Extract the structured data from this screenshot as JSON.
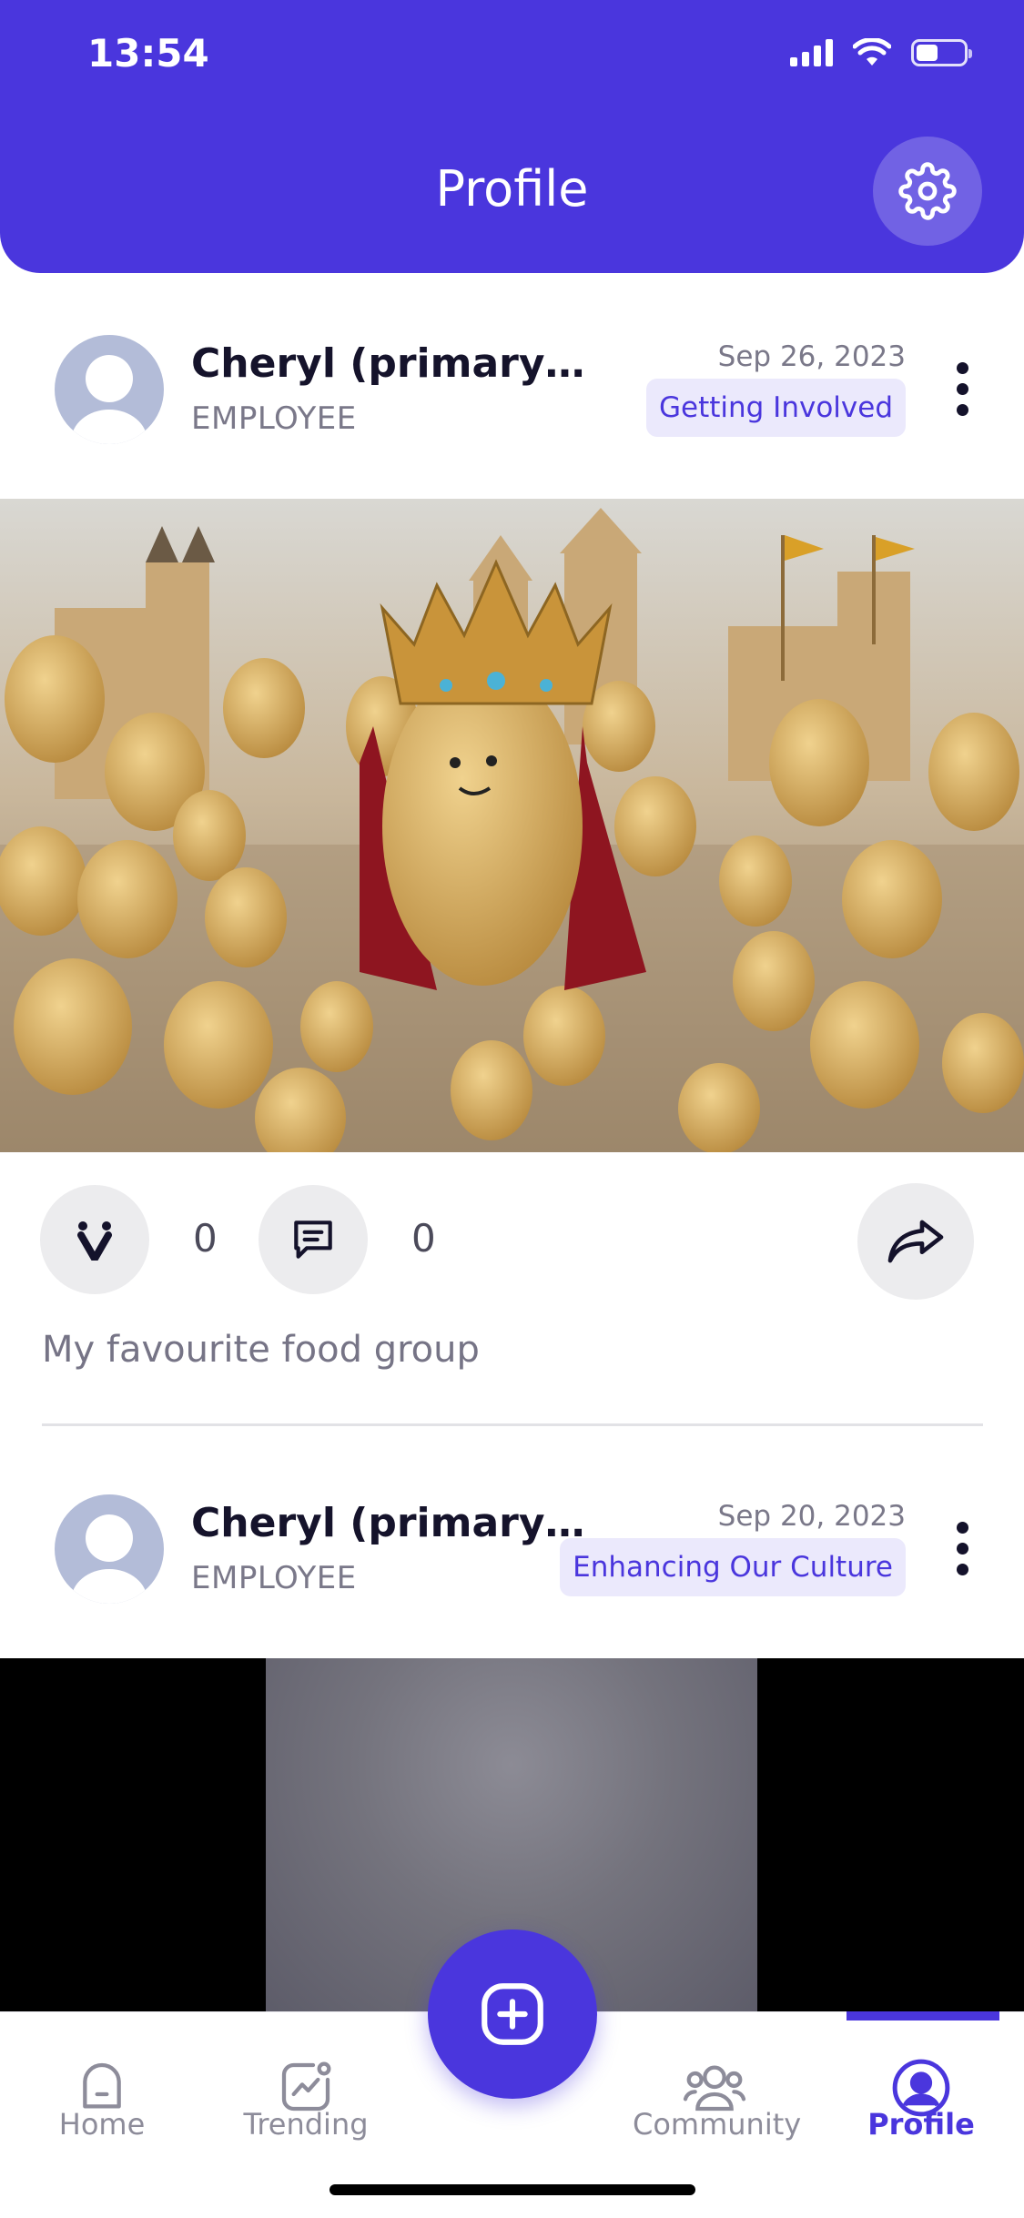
{
  "status": {
    "time": "13:54"
  },
  "header": {
    "title": "Profile"
  },
  "posts": [
    {
      "author": "Cheryl (primary…",
      "role": "EMPLOYEE",
      "date": "Sep 26, 2023",
      "tag": "Getting Involved",
      "reactions": "0",
      "comments": "0",
      "caption": "My favourite food group"
    },
    {
      "author": "Cheryl (primary…",
      "role": "EMPLOYEE",
      "date": "Sep 20, 2023",
      "tag": "Enhancing Our Culture"
    }
  ],
  "nav": {
    "items": [
      {
        "label": "Home",
        "icon": "home-icon"
      },
      {
        "label": "Trending",
        "icon": "trending-icon"
      },
      {
        "label": "Community",
        "icon": "community-icon"
      },
      {
        "label": "Profile",
        "icon": "profile-icon",
        "active": true
      }
    ]
  },
  "colors": {
    "brand": "#4a36dd",
    "tag_bg": "#ebe9fc"
  }
}
